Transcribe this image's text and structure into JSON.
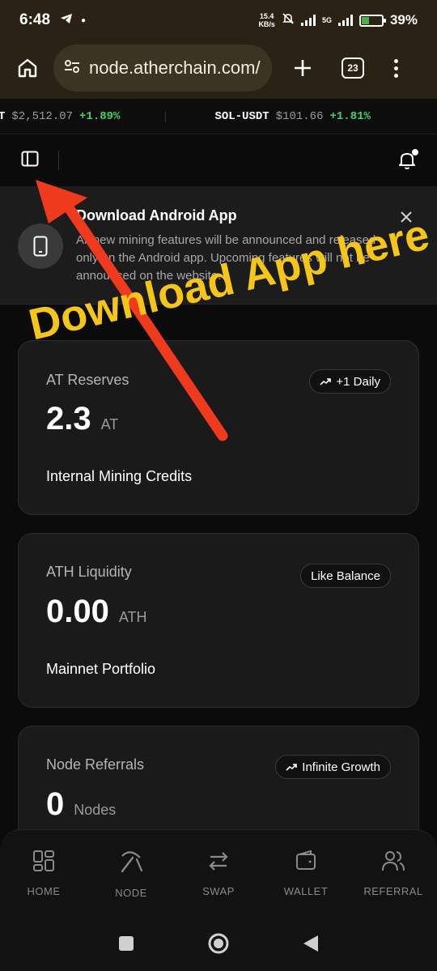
{
  "status_bar": {
    "time": "6:48",
    "net_speed_value": "15.4",
    "net_speed_unit": "KB/s",
    "network": "5G",
    "battery": "39%",
    "battery_level": 0.39
  },
  "browser": {
    "url": "node.atherchain.com/",
    "tab_count": "23"
  },
  "ticker": [
    {
      "pair": "T",
      "price": "$2,512.07",
      "change": "+1.89%"
    },
    {
      "pair": "SOL-USDT",
      "price": "$101.66",
      "change": "+1.81%"
    }
  ],
  "banner": {
    "title": "Download Android App",
    "body": "All new mining features will be announced and released only on the Android app. Upcoming features will not be announced on the website."
  },
  "annotation": {
    "text": "Download App here"
  },
  "cards": [
    {
      "label": "AT Reserves",
      "value": "2.3",
      "unit": "AT",
      "subtitle": "Internal Mining Credits",
      "pill": "+1 Daily",
      "pill_icon": "trending-up-icon"
    },
    {
      "label": "ATH Liquidity",
      "value": "0.00",
      "unit": "ATH",
      "subtitle": "Mainnet Portfolio",
      "pill": "Like Balance",
      "pill_icon": ""
    },
    {
      "label": "Node Referrals",
      "value": "0",
      "unit": "Nodes",
      "subtitle": "",
      "pill": "Infinite Growth",
      "pill_icon": "trending-up-icon"
    }
  ],
  "bottom_nav": [
    {
      "label": "HOME",
      "icon": "grid-icon"
    },
    {
      "label": "NODE",
      "icon": "pickaxe-icon"
    },
    {
      "label": "SWAP",
      "icon": "swap-icon"
    },
    {
      "label": "WALLET",
      "icon": "wallet-icon"
    },
    {
      "label": "REFERRAL",
      "icon": "users-icon"
    }
  ],
  "colors": {
    "accent_green": "#3fd26b",
    "annotation_yellow": "#f5c518",
    "arrow_red": "#f03a1e"
  }
}
